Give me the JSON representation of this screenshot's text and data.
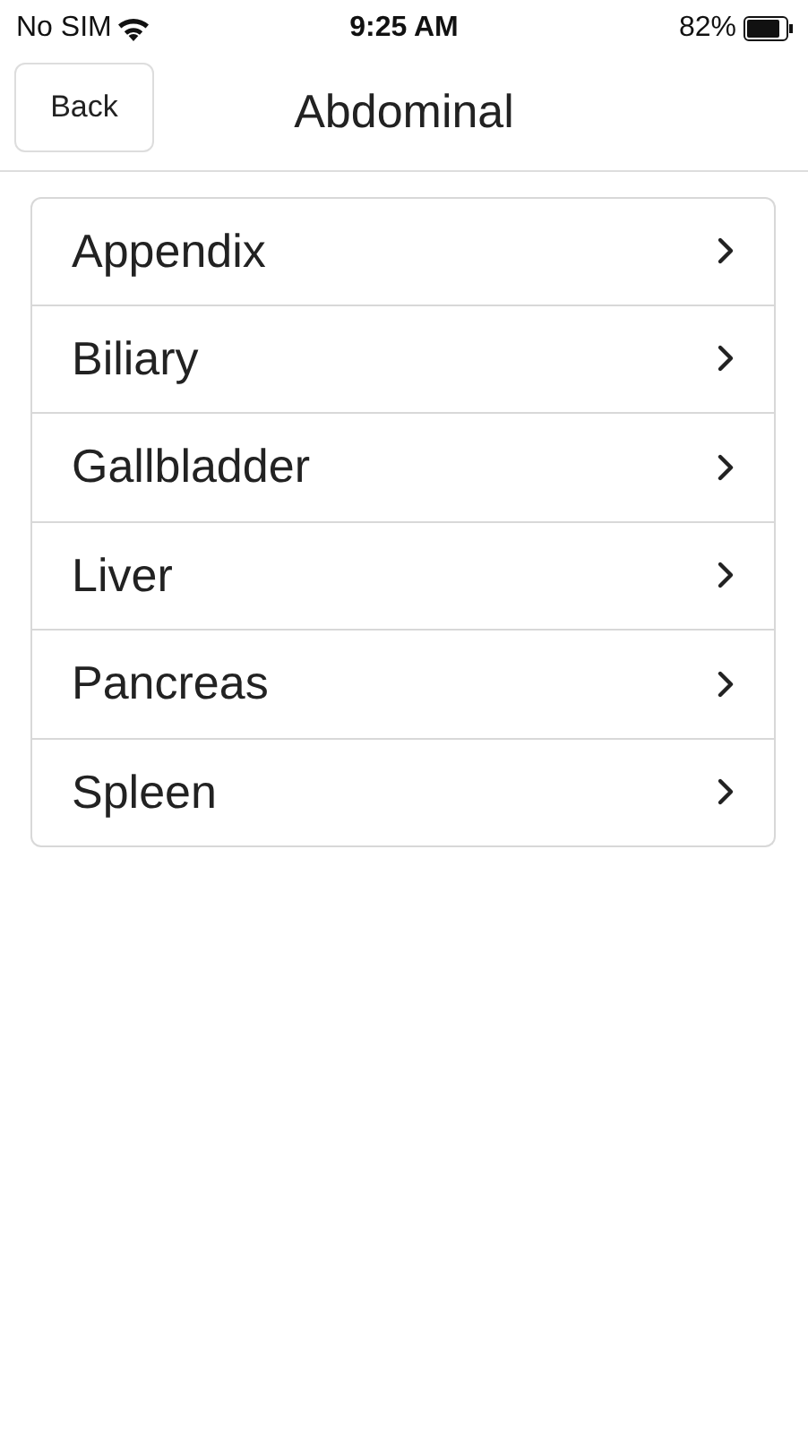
{
  "status_bar": {
    "carrier": "No SIM",
    "time": "9:25 AM",
    "battery": "82%"
  },
  "nav_bar": {
    "back": "Back",
    "title": "Abdominal"
  },
  "items": [
    {
      "label": "Appendix"
    },
    {
      "label": "Biliary"
    },
    {
      "label": "Gallbladder"
    },
    {
      "label": "Liver"
    },
    {
      "label": "Pancreas"
    },
    {
      "label": "Spleen"
    }
  ]
}
